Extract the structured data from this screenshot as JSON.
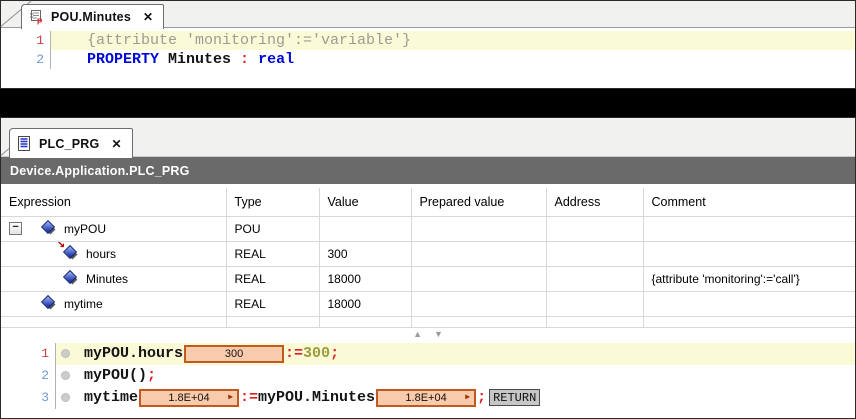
{
  "icons": {
    "close": "✕",
    "value_expand_arrow": "▶",
    "splitter_up": "▲",
    "splitter_down": "▼",
    "input_arrow": "↘",
    "collapse": "−"
  },
  "colors": {
    "value_box_fill": "#F8CBAD",
    "value_box_border": "#C05A1E",
    "keyword_blue": "#0008D8",
    "operator_red": "#E01F1F",
    "number_olive": "#9C9C3F",
    "comment_gray": "#9C9C96",
    "highlight_yellow": "#FAFAD7",
    "titlebar_gray": "#6A6A6A"
  },
  "top_editor": {
    "tab": {
      "label": "POU.Minutes",
      "icon": "property-pou-icon"
    },
    "lines": [
      {
        "num": "1",
        "num_color": "red",
        "highlight": true,
        "segments": [
          {
            "k": "comment",
            "t": "{attribute 'monitoring':='variable'}"
          }
        ]
      },
      {
        "num": "2",
        "num_color": "blue",
        "highlight": false,
        "segments": [
          {
            "k": "kw",
            "t": "PROPERTY"
          },
          {
            "k": "plain",
            "t": " Minutes "
          },
          {
            "k": "op",
            "t": ":"
          },
          {
            "k": "plain",
            "t": " "
          },
          {
            "k": "kw",
            "t": "real"
          }
        ]
      }
    ]
  },
  "bottom_editor": {
    "tab": {
      "label": "PLC_PRG",
      "icon": "program-document-icon"
    },
    "breadcrumb": "Device.Application.PLC_PRG",
    "watch_table": {
      "columns": [
        "Expression",
        "Type",
        "Value",
        "Prepared value",
        "Address",
        "Comment"
      ],
      "rows": [
        {
          "expression": "myPOU",
          "type": "POU",
          "value": "",
          "prepared_value": "",
          "address": "",
          "comment": "",
          "level": 0,
          "has_expand": true,
          "icon": "variable-icon"
        },
        {
          "expression": "hours",
          "type": "REAL",
          "value": "300",
          "prepared_value": "",
          "address": "",
          "comment": "",
          "level": 1,
          "has_expand": false,
          "icon": "input-variable-icon"
        },
        {
          "expression": "Minutes",
          "type": "REAL",
          "value": "18000",
          "prepared_value": "",
          "address": "",
          "comment": "{attribute 'monitoring':='call'}",
          "level": 1,
          "has_expand": false,
          "icon": "variable-icon"
        },
        {
          "expression": "mytime",
          "type": "REAL",
          "value": "18000",
          "prepared_value": "",
          "address": "",
          "comment": "",
          "level": 0,
          "has_expand": false,
          "icon": "variable-icon"
        }
      ]
    },
    "code_lines": [
      {
        "num": "1",
        "num_color": "red",
        "highlight": true,
        "segments": [
          {
            "k": "id",
            "t": "myPOU.hours"
          },
          {
            "k": "box",
            "t": "300",
            "arrow": false
          },
          {
            "k": "op",
            "t": ":="
          },
          {
            "k": "num",
            "t": "300"
          },
          {
            "k": "op",
            "t": ";"
          }
        ]
      },
      {
        "num": "2",
        "num_color": "blue",
        "highlight": false,
        "segments": [
          {
            "k": "id",
            "t": "myPOU()"
          },
          {
            "k": "op",
            "t": ";"
          }
        ]
      },
      {
        "num": "3",
        "num_color": "blue",
        "highlight": false,
        "segments": [
          {
            "k": "id",
            "t": "mytime"
          },
          {
            "k": "box",
            "t": "1.8E+04",
            "arrow": true
          },
          {
            "k": "op",
            "t": ":="
          },
          {
            "k": "id",
            "t": "myPOU.Minutes"
          },
          {
            "k": "box",
            "t": "1.8E+04",
            "arrow": true
          },
          {
            "k": "op",
            "t": ";"
          },
          {
            "k": "ret",
            "t": "RETURN"
          }
        ]
      }
    ]
  }
}
